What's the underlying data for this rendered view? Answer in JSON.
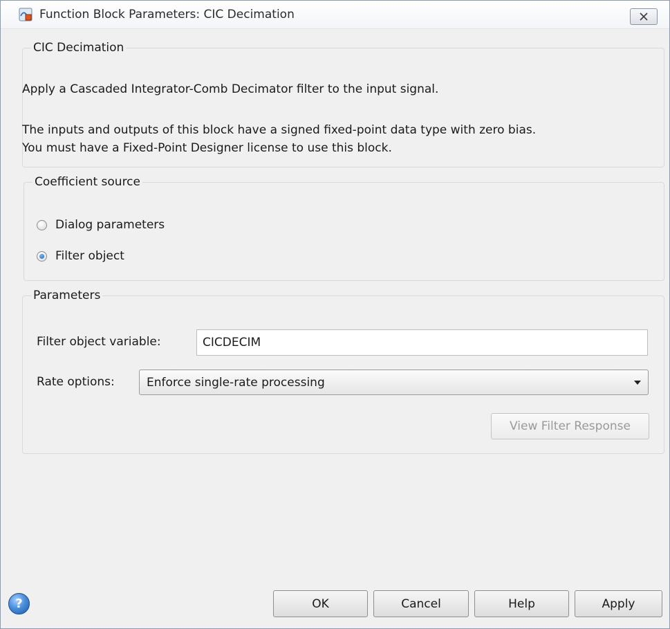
{
  "window": {
    "title": "Function Block Parameters: CIC Decimation",
    "icons": {
      "app": "simulink-block-icon",
      "close": "close-icon"
    }
  },
  "description_group": {
    "legend": "CIC Decimation",
    "line1": "Apply a Cascaded Integrator-Comb Decimator filter to the input signal.",
    "line2": "The inputs and outputs of this block have a signed fixed-point data type with zero bias.",
    "line3": "You must have a Fixed-Point Designer license to use this block."
  },
  "coefficient_source": {
    "legend": "Coefficient source",
    "options": [
      {
        "label": "Dialog parameters",
        "selected": false
      },
      {
        "label": "Filter object",
        "selected": true
      }
    ]
  },
  "parameters": {
    "legend": "Parameters",
    "filter_object_label": "Filter object variable:",
    "filter_object_value": "CICDECIM",
    "rate_options_label": "Rate options:",
    "rate_options_value": "Enforce single-rate processing",
    "view_response_label": "View Filter Response"
  },
  "footer": {
    "ok": "OK",
    "cancel": "Cancel",
    "help": "Help",
    "apply": "Apply",
    "help_icon_glyph": "?"
  },
  "colors": {
    "window_bg": "#f0f0f0",
    "accent_blue": "#1565c0",
    "disabled_text": "#9a9a9a"
  }
}
